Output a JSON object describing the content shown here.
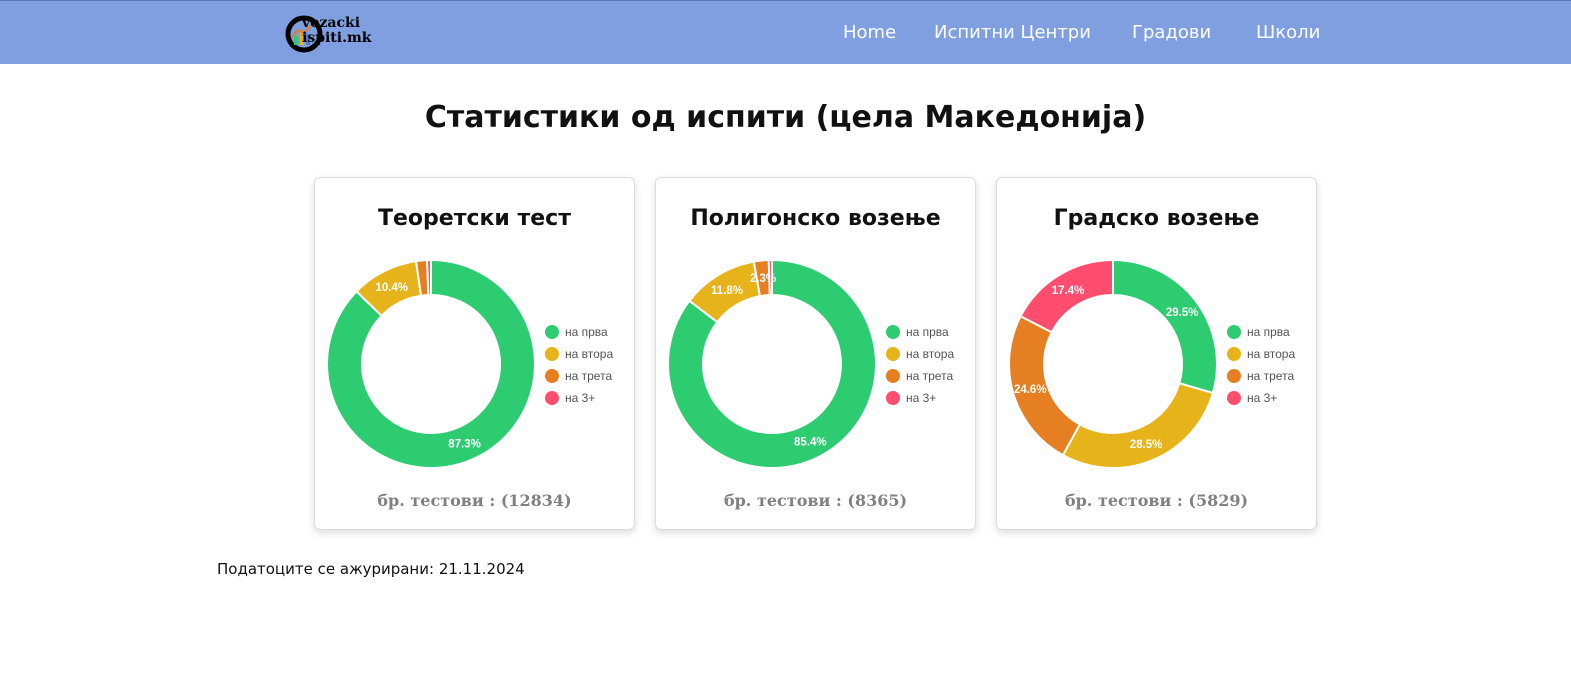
{
  "header": {
    "logo": {
      "line1": "vozacki",
      "line2": "ispiti.mk"
    },
    "nav": [
      {
        "label": "Home"
      },
      {
        "label": "Испитни Центри"
      },
      {
        "label": "Градови"
      },
      {
        "label": "Школи"
      }
    ],
    "background_color": "#7f9fe0"
  },
  "page_title": "Статистики од испити (цела Македонија)",
  "legend_labels": [
    "на прва",
    "на втора",
    "на трета",
    "на 3+"
  ],
  "series_colors": [
    "#2ecc71",
    "#e6b31a",
    "#e67e22",
    "#ff4d6d"
  ],
  "cards": [
    {
      "title": "Теоретски тест",
      "count_text": "бр. тестови : (12834)"
    },
    {
      "title": "Полигонско возење",
      "count_text": "бр. тестови : (8365)"
    },
    {
      "title": "Градско возење",
      "count_text": "бр. тестови : (5829)"
    }
  ],
  "chart_data": [
    {
      "type": "pie",
      "title": "Теоретски тест",
      "categories": [
        "на прва",
        "на втора",
        "на трета",
        "на 3+"
      ],
      "values": [
        87.3,
        10.4,
        1.7,
        0.6
      ],
      "labels": [
        "87.3%",
        "10.4%",
        "",
        ""
      ],
      "legend": "right"
    },
    {
      "type": "pie",
      "title": "Полигонско возење",
      "categories": [
        "на прва",
        "на втора",
        "на трета",
        "на 3+"
      ],
      "values": [
        85.4,
        11.8,
        2.3,
        0.5
      ],
      "labels": [
        "85.4%",
        "11.8%",
        "2.3%",
        ""
      ],
      "legend": "right"
    },
    {
      "type": "pie",
      "title": "Градско возење",
      "categories": [
        "на прва",
        "на втора",
        "на трета",
        "на 3+"
      ],
      "values": [
        29.5,
        28.5,
        24.6,
        17.4
      ],
      "labels": [
        "29.5%",
        "28.5%",
        "24.6%",
        "17.4%"
      ],
      "legend": "right"
    }
  ],
  "updated_text": "Податоците се ажурирани: 21.11.2024"
}
